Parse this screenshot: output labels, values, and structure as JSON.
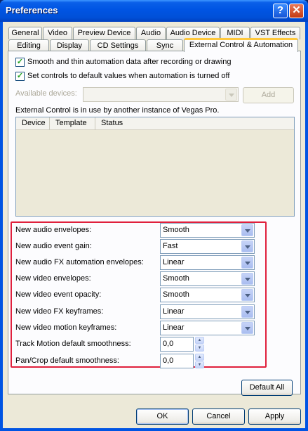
{
  "window": {
    "title": "Preferences",
    "help_label": "?",
    "close_label": "✕"
  },
  "tabs_row1": [
    "General",
    "Video",
    "Preview Device",
    "Audio",
    "Audio Device",
    "MIDI",
    "VST Effects"
  ],
  "tabs_row2": [
    "Editing",
    "Display",
    "CD Settings",
    "Sync",
    "External Control & Automation"
  ],
  "active_tab": "External Control & Automation",
  "options": {
    "smooth_label": "Smooth and thin automation data after recording or drawing",
    "smooth_checked": true,
    "default_label": "Set controls to default values when automation is turned off",
    "default_checked": true
  },
  "devices": {
    "available_label": "Available devices:",
    "available_value": "",
    "add_label": "Add",
    "status_text": "External Control is in use by another instance of Vegas Pro.",
    "columns": [
      "Device",
      "Template",
      "Status"
    ]
  },
  "settings": [
    {
      "label": "New audio envelopes:",
      "value": "Smooth"
    },
    {
      "label": "New audio event gain:",
      "value": "Fast"
    },
    {
      "label": "New audio FX automation envelopes:",
      "value": "Linear"
    },
    {
      "label": "New video envelopes:",
      "value": "Smooth"
    },
    {
      "label": "New video event opacity:",
      "value": "Smooth"
    },
    {
      "label": "New video FX keyframes:",
      "value": "Linear"
    },
    {
      "label": "New video motion keyframes:",
      "value": "Linear"
    }
  ],
  "smoothness": [
    {
      "label": "Track Motion default smoothness:",
      "value": "0,0"
    },
    {
      "label": "Pan/Crop default smoothness:",
      "value": "0,0"
    }
  ],
  "buttons": {
    "default_all": "Default All",
    "ok": "OK",
    "cancel": "Cancel",
    "apply": "Apply"
  },
  "colors": {
    "highlight_border": "#e0203c",
    "titlebar": "#0054e3",
    "checkmark": "#21a121"
  }
}
